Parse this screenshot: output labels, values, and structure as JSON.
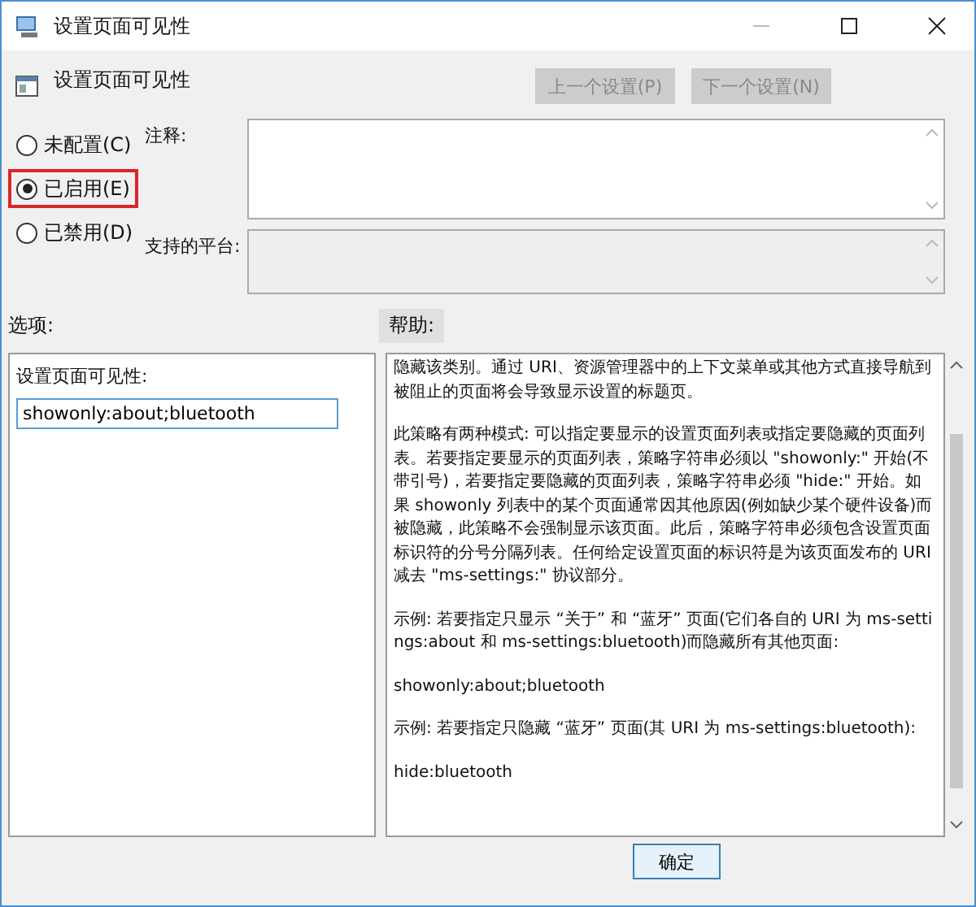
{
  "window": {
    "title": "设置页面可见性"
  },
  "header": {
    "title": "设置页面可见性",
    "buttons": [
      {
        "label": "上一个设置(P)",
        "disabled": true
      },
      {
        "label": "下一个设置(N)",
        "disabled": true
      }
    ]
  },
  "state_options": [
    {
      "label": "未配置(C)",
      "selected": false,
      "highlighted": false
    },
    {
      "label": "已启用(E)",
      "selected": true,
      "highlighted": true
    },
    {
      "label": "已禁用(D)",
      "selected": false,
      "highlighted": false
    }
  ],
  "comment": {
    "label": "注释:"
  },
  "platform": {
    "label": "支持的平台:"
  },
  "options": {
    "label": "选项:",
    "field_label": "设置页面可见性:",
    "value": "showonly:about;bluetooth"
  },
  "help": {
    "label": "帮助:",
    "paragraphs": [
      "隐藏该类别。通过 URI、资源管理器中的上下文菜单或其他方式直接导航到被阻止的页面将会导致显示设置的标题页。",
      "此策略有两种模式: 可以指定要显示的设置页面列表或指定要隐藏的页面列表。若要指定要显示的页面列表，策略字符串必须以 \"showonly:\" 开始(不带引号)，若要指定要隐藏的页面列表，策略字符串必须 \"hide:\" 开始。如果 showonly 列表中的某个页面通常因其他原因(例如缺少某个硬件设备)而被隐藏，此策略不会强制显示该页面。此后，策略字符串必须包含设置页面标识符的分号分隔列表。任何给定设置页面的标识符是为该页面发布的 URI 减去 \"ms-settings:\" 协议部分。",
      "示例: 若要指定只显示 “关于” 和 “蓝牙” 页面(它们各自的 URI 为 ms-settings:about 和 ms-settings:bluetooth)而隐藏所有其他页面:",
      "showonly:about;bluetooth",
      "示例: 若要指定只隐藏 “蓝牙” 页面(其 URI 为 ms-settings:bluetooth):",
      "hide:bluetooth"
    ]
  },
  "footer": {
    "buttons": [
      "确定"
    ]
  }
}
